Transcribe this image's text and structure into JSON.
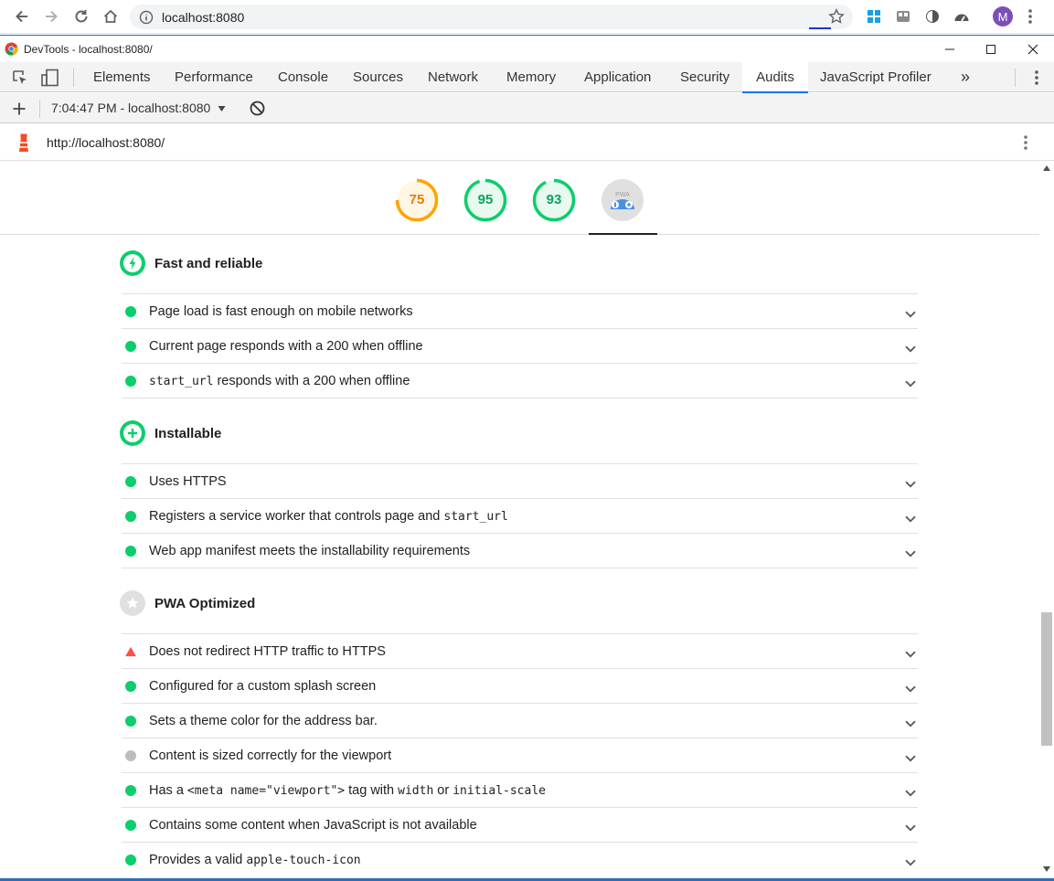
{
  "browser": {
    "url": "localhost:8080",
    "avatar_letter": "M"
  },
  "devtools": {
    "window_title": "DevTools - localhost:8080/",
    "tabs": [
      {
        "label": "Elements"
      },
      {
        "label": "Performance"
      },
      {
        "label": "Console"
      },
      {
        "label": "Sources"
      },
      {
        "label": "Network"
      },
      {
        "label": "Memory"
      },
      {
        "label": "Application"
      },
      {
        "label": "Security"
      },
      {
        "label": "Audits",
        "active": true
      },
      {
        "label": "JavaScript Profiler"
      }
    ],
    "more_tabs_label": "»",
    "report_selector": "7:04:47 PM - localhost:8080"
  },
  "lighthouse": {
    "url": "http://localhost:8080/",
    "scores": [
      {
        "value": "75",
        "fraction": 0.75,
        "color": "#ffa400",
        "fill": "#fff6e5"
      },
      {
        "value": "95",
        "fraction": 0.95,
        "color": "#0cce6b",
        "fill": "#e8f9ef"
      },
      {
        "value": "93",
        "fraction": 0.93,
        "color": "#0cce6b",
        "fill": "#e8f9ef"
      }
    ],
    "pwa_badge_text": "PWA",
    "groups": [
      {
        "title": "Fast and reliable",
        "icon": "lightning-icon",
        "audits": [
          {
            "status": "pass",
            "parts": [
              {
                "t": "Page load is fast enough on mobile networks"
              }
            ]
          },
          {
            "status": "pass",
            "parts": [
              {
                "t": "Current page responds with a 200 when offline"
              }
            ]
          },
          {
            "status": "pass",
            "parts": [
              {
                "t": "start_url",
                "code": true
              },
              {
                "t": " responds with a 200 when offline"
              }
            ]
          }
        ]
      },
      {
        "title": "Installable",
        "icon": "plus-icon",
        "audits": [
          {
            "status": "pass",
            "parts": [
              {
                "t": "Uses HTTPS"
              }
            ]
          },
          {
            "status": "pass",
            "parts": [
              {
                "t": "Registers a service worker that controls page and "
              },
              {
                "t": "start_url",
                "code": true
              }
            ]
          },
          {
            "status": "pass",
            "parts": [
              {
                "t": "Web app manifest meets the installability requirements"
              }
            ]
          }
        ]
      },
      {
        "title": "PWA Optimized",
        "icon": "star-icon",
        "audits": [
          {
            "status": "fail",
            "parts": [
              {
                "t": "Does not redirect HTTP traffic to HTTPS"
              }
            ]
          },
          {
            "status": "pass",
            "parts": [
              {
                "t": "Configured for a custom splash screen"
              }
            ]
          },
          {
            "status": "pass",
            "parts": [
              {
                "t": "Sets a theme color for the address bar."
              }
            ]
          },
          {
            "status": "na",
            "parts": [
              {
                "t": "Content is sized correctly for the viewport"
              }
            ]
          },
          {
            "status": "pass",
            "parts": [
              {
                "t": "Has a "
              },
              {
                "t": "<meta name=\"viewport\">",
                "code": true
              },
              {
                "t": " tag with "
              },
              {
                "t": "width",
                "code": true
              },
              {
                "t": " or "
              },
              {
                "t": "initial-scale",
                "code": true
              }
            ]
          },
          {
            "status": "pass",
            "parts": [
              {
                "t": "Contains some content when JavaScript is not available"
              }
            ]
          },
          {
            "status": "pass",
            "parts": [
              {
                "t": "Provides a valid "
              },
              {
                "t": "apple-touch-icon",
                "code": true
              }
            ]
          }
        ]
      }
    ]
  },
  "colors": {
    "pass": "#0cce6b",
    "fail": "#ff4e42",
    "na": "#bdbdbd",
    "accent": "#1a73e8"
  }
}
